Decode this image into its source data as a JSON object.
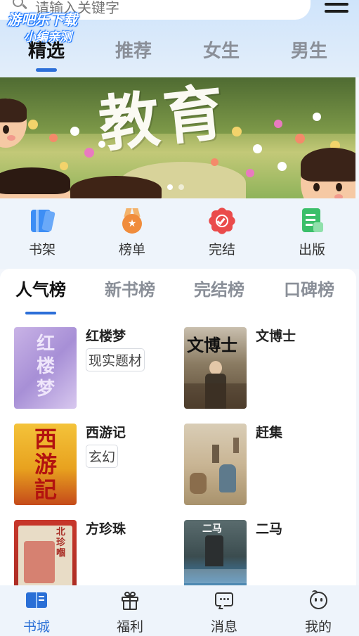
{
  "search": {
    "placeholder": "请输入关键字"
  },
  "watermark": {
    "line1": "游吧乐下载",
    "line2": "小编亲测"
  },
  "top_tabs": [
    {
      "label": "精选",
      "active": true
    },
    {
      "label": "推荐",
      "active": false
    },
    {
      "label": "女生",
      "active": false
    },
    {
      "label": "男生",
      "active": false
    }
  ],
  "banner": {
    "title": "教育",
    "page_count": 2,
    "current_page": 1
  },
  "quick_nav": [
    {
      "label": "书架",
      "icon": "bookshelf-icon",
      "color": "#3d8ef5"
    },
    {
      "label": "榜单",
      "icon": "medal-icon",
      "color": "#f08c3c"
    },
    {
      "label": "完结",
      "icon": "completed-badge-icon",
      "color": "#ea4b4b"
    },
    {
      "label": "出版",
      "icon": "publish-icon",
      "color": "#3bbf6a"
    }
  ],
  "rank_tabs": [
    {
      "label": "人气榜",
      "active": true
    },
    {
      "label": "新书榜",
      "active": false
    },
    {
      "label": "完结榜",
      "active": false
    },
    {
      "label": "口碑榜",
      "active": false
    }
  ],
  "books": [
    {
      "title": "红楼梦",
      "tag": "现实题材",
      "cover_text": "红楼梦"
    },
    {
      "title": "文博士",
      "tag": "",
      "cover_text": "文博士"
    },
    {
      "title": "西游记",
      "tag": "玄幻",
      "cover_text": "西游記"
    },
    {
      "title": "赶集",
      "tag": "",
      "cover_text": ""
    },
    {
      "title": "方珍珠",
      "tag": "",
      "cover_text": "北珍嗰"
    },
    {
      "title": "二马",
      "tag": "",
      "cover_text": "二马"
    }
  ],
  "bottom_nav": [
    {
      "label": "书城",
      "icon": "bookstore-icon",
      "active": true
    },
    {
      "label": "福利",
      "icon": "gift-icon",
      "active": false
    },
    {
      "label": "消息",
      "icon": "message-icon",
      "active": false
    },
    {
      "label": "我的",
      "icon": "profile-icon",
      "active": false
    }
  ],
  "colors": {
    "accent": "#2c6fd8",
    "active_nav": "#2a6fd6"
  }
}
